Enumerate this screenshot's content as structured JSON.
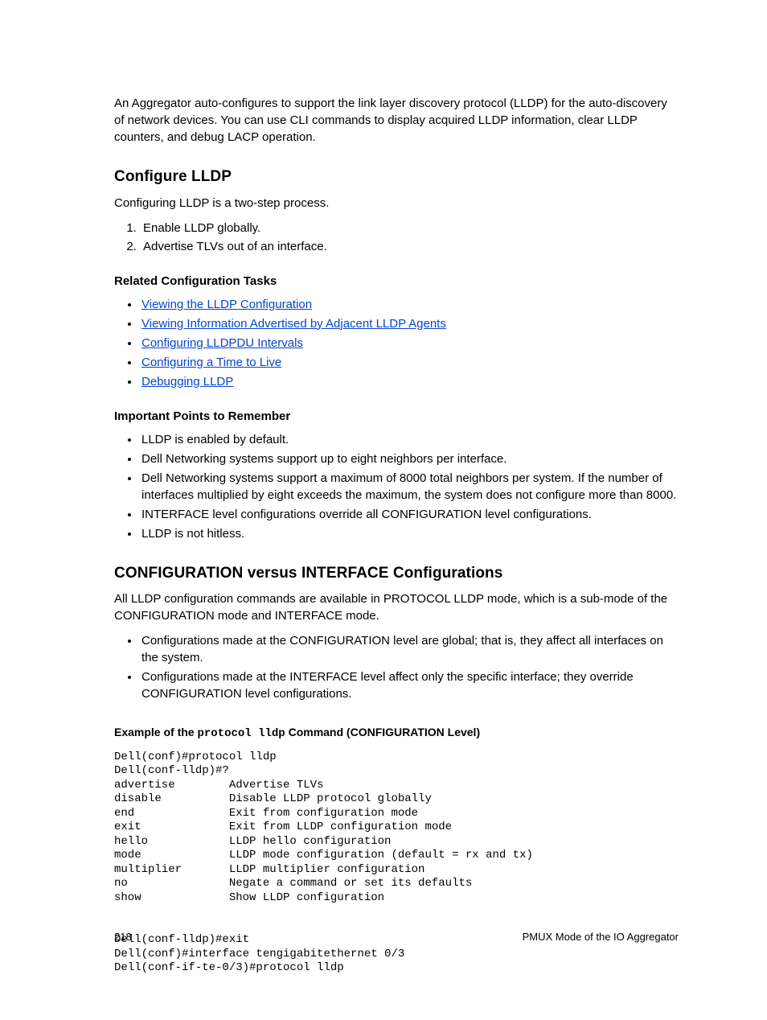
{
  "intro": "An Aggregator auto-configures to support the link layer discovery protocol (LLDP) for the auto-discovery of network devices. You can use CLI commands to display acquired LLDP information, clear LLDP counters, and debug LACP operation.",
  "section_configure": {
    "title": "Configure LLDP",
    "lead": "Configuring LLDP is a two-step process.",
    "steps": [
      "Enable LLDP globally.",
      "Advertise TLVs out of an interface."
    ]
  },
  "related": {
    "title": "Related Configuration Tasks",
    "links": [
      "Viewing the LLDP Configuration",
      "Viewing Information Advertised by Adjacent LLDP Agents",
      "Configuring LLDPDU Intervals",
      "Configuring a Time to Live",
      "Debugging LLDP"
    ]
  },
  "important": {
    "title": "Important Points to Remember",
    "items": [
      "LLDP is enabled by default.",
      "Dell Networking systems support up to eight neighbors per interface.",
      "Dell Networking systems support a maximum of 8000 total neighbors per system. If the number of interfaces multiplied by eight exceeds the maximum, the system does not configure more than 8000.",
      "INTERFACE level configurations override all CONFIGURATION level configurations.",
      "LLDP is not hitless."
    ]
  },
  "section_config_vs_iface": {
    "title": "CONFIGURATION versus INTERFACE Configurations",
    "lead": "All LLDP configuration commands are available in PROTOCOL LLDP mode, which is a sub-mode of the CONFIGURATION mode and INTERFACE mode.",
    "items": [
      "Configurations made at the CONFIGURATION level are global; that is, they affect all interfaces on the system.",
      "Configurations made at the INTERFACE level affect only the specific interface; they override CONFIGURATION level configurations."
    ]
  },
  "example": {
    "caption_prefix": "Example of the ",
    "caption_cmd": "protocol lldp",
    "caption_suffix": " Command (CONFIGURATION Level)",
    "cli": "Dell(conf)#protocol lldp\nDell(conf-lldp)#?\nadvertise        Advertise TLVs\ndisable          Disable LLDP protocol globally\nend              Exit from configuration mode\nexit             Exit from LLDP configuration mode\nhello            LLDP hello configuration\nmode             LLDP mode configuration (default = rx and tx)\nmultiplier       LLDP multiplier configuration\nno               Negate a command or set its defaults\nshow             Show LLDP configuration\n\n\nDell(conf-lldp)#exit\nDell(conf)#interface tengigabitethernet 0/3\nDell(conf-if-te-0/3)#protocol lldp"
  },
  "footer": {
    "page_number": "218",
    "doc_title": "PMUX Mode of the IO Aggregator"
  }
}
